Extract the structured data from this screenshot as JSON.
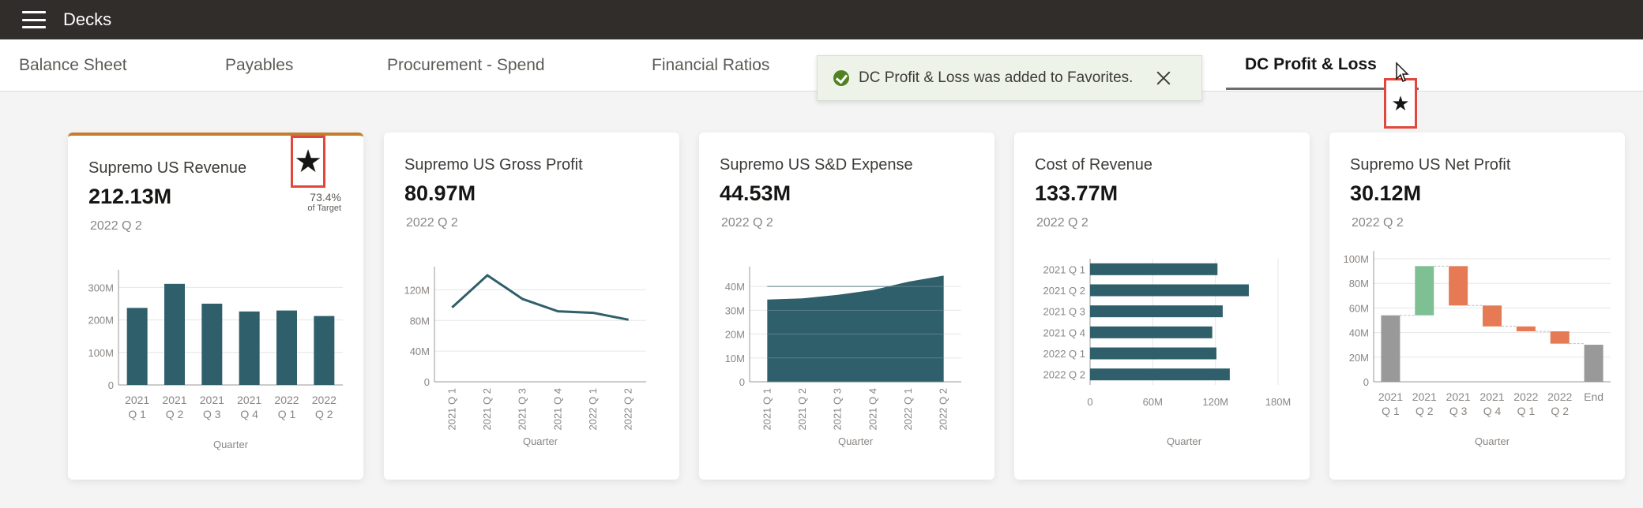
{
  "app": {
    "title": "Decks"
  },
  "tabs": [
    {
      "label": "Balance Sheet"
    },
    {
      "label": "Payables"
    },
    {
      "label": "Procurement - Spend"
    },
    {
      "label": "Financial Ratios"
    },
    {
      "label": "DC Profit & Loss",
      "active": true
    }
  ],
  "toast": {
    "message": "DC Profit & Loss was added to Favorites."
  },
  "icons": {
    "favorite": "★"
  },
  "colors": {
    "bar": "#2f5f6b",
    "increase": "#7ec094",
    "decrease": "#e57a54",
    "total": "#999999",
    "highlight": "#c47d2c",
    "annotation": "#e0483d"
  },
  "cards": [
    {
      "title": "Supremo US Revenue",
      "value": "212.13M",
      "period": "2022 Q 2",
      "target_pct": "73.4%",
      "target_label": "of Target"
    },
    {
      "title": "Supremo US Gross Profit",
      "value": "80.97M",
      "period": "2022 Q 2"
    },
    {
      "title": "Supremo US S&D Expense",
      "value": "44.53M",
      "period": "2022 Q 2"
    },
    {
      "title": "Cost of Revenue",
      "value": "133.77M",
      "period": "2022 Q 2"
    },
    {
      "title": "Supremo US Net Profit",
      "value": "30.12M",
      "period": "2022 Q 2"
    }
  ],
  "chart_data": [
    {
      "type": "bar",
      "categories": [
        "2021 Q 1",
        "2021 Q 2",
        "2021 Q 3",
        "2021 Q 4",
        "2022 Q 1",
        "2022 Q 2"
      ],
      "values": [
        237,
        311,
        250,
        226,
        229,
        212
      ],
      "ylim": [
        0,
        330
      ],
      "yticks": [
        0,
        100,
        200,
        300
      ],
      "ytick_labels": [
        "0",
        "100M",
        "200M",
        "300M"
      ],
      "xlabel": "Quarter",
      "grid": true
    },
    {
      "type": "line",
      "categories": [
        "2021 Q 1",
        "2021 Q 2",
        "2021 Q 3",
        "2021 Q 4",
        "2022 Q 1",
        "2022 Q 2"
      ],
      "values": [
        97,
        139,
        108,
        92,
        90,
        81
      ],
      "ylim": [
        0,
        140
      ],
      "yticks": [
        0,
        40,
        80,
        120
      ],
      "ytick_labels": [
        "0",
        "40M",
        "80M",
        "120M"
      ],
      "xlabel": "Quarter",
      "grid": true
    },
    {
      "type": "area",
      "categories": [
        "2021 Q 1",
        "2021 Q 2",
        "2021 Q 3",
        "2021 Q 4",
        "2022 Q 1",
        "2022 Q 2"
      ],
      "values": [
        34.5,
        35,
        36.5,
        38.5,
        42,
        44.53
      ],
      "ylim": [
        0,
        45
      ],
      "yticks": [
        0,
        10,
        20,
        30,
        40
      ],
      "ytick_labels": [
        "0",
        "10M",
        "20M",
        "30M",
        "40M"
      ],
      "xlabel": "Quarter",
      "grid": true
    },
    {
      "type": "bar",
      "orientation": "horizontal",
      "categories": [
        "2021 Q 1",
        "2021 Q 2",
        "2021 Q 3",
        "2021 Q 4",
        "2022 Q 1",
        "2022 Q 2"
      ],
      "values": [
        122,
        152,
        127,
        117,
        121,
        133.77
      ],
      "xlim": [
        0,
        180
      ],
      "xticks": [
        0,
        60,
        120,
        180
      ],
      "xtick_labels": [
        "0",
        "60M",
        "120M",
        "180M"
      ],
      "xlabel": "Quarter",
      "grid": true
    },
    {
      "type": "bar",
      "subtype": "waterfall",
      "categories": [
        "2021 Q 1",
        "2021 Q 2",
        "2021 Q 3",
        "2021 Q 4",
        "2022 Q 1",
        "2022 Q 2",
        "End"
      ],
      "values": [
        54,
        40,
        -32,
        -17,
        -4,
        -10,
        30.12
      ],
      "kinds": [
        "total",
        "increase",
        "decrease",
        "decrease",
        "decrease",
        "decrease",
        "total"
      ],
      "ylim": [
        0,
        100
      ],
      "yticks": [
        0,
        20,
        40,
        60,
        80,
        100
      ],
      "ytick_labels": [
        "0",
        "20M",
        "40M",
        "60M",
        "80M",
        "100M"
      ],
      "xlabel": "Quarter",
      "grid": true
    }
  ]
}
